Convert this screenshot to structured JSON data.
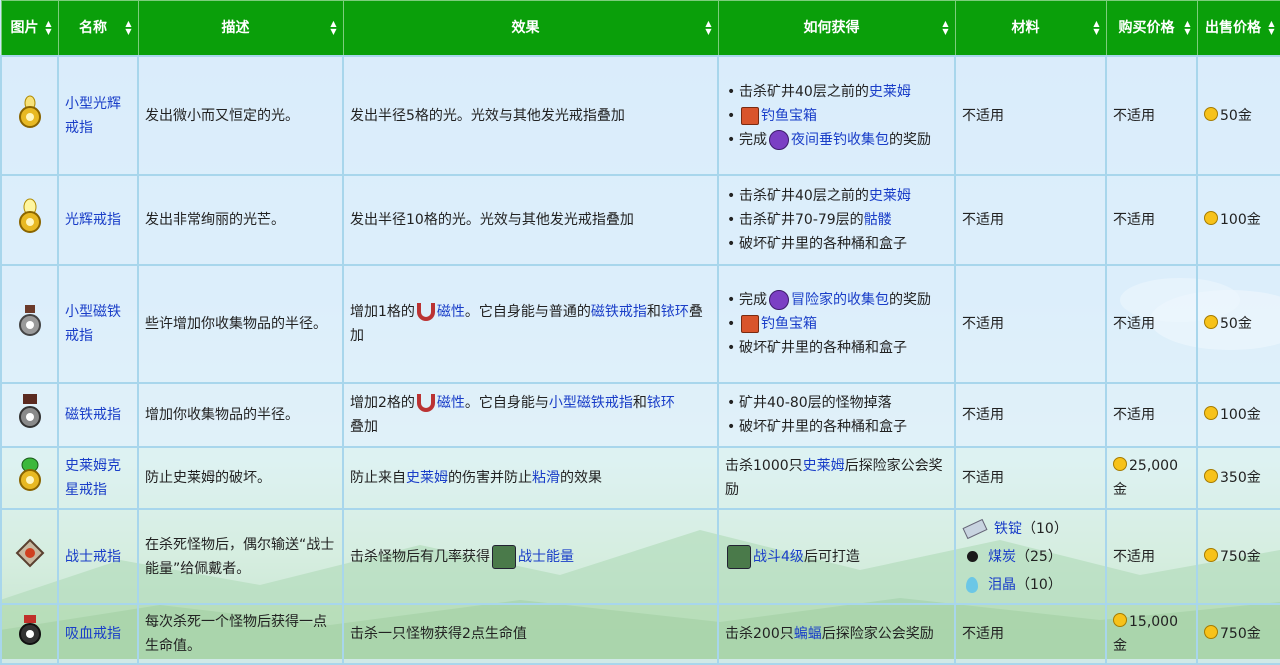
{
  "headers": [
    "图片",
    "名称",
    "描述",
    "效果",
    "如何获得",
    "材料",
    "购买价格",
    "出售价格"
  ],
  "rows": [
    {
      "name": "小型光辉戒指",
      "desc": "发出微小而又恒定的光。",
      "effect": "发出半径5格的光。光效与其他发光戒指叠加",
      "obtain": [
        {
          "pre": "击杀矿井40层之前的",
          "link": "史莱姆",
          "post": ""
        },
        {
          "pre": "",
          "link": "钓鱼宝箱",
          "post": ""
        },
        {
          "pre": "完成",
          "link": "夜间垂钓收集包",
          "post": "的奖励"
        }
      ],
      "material": "不适用",
      "buy": "不适用",
      "sell": "50金"
    },
    {
      "name": "光辉戒指",
      "desc": "发出非常绚丽的光芒。",
      "effect": "发出半径10格的光。光效与其他发光戒指叠加",
      "obtain": [
        {
          "pre": "击杀矿井40层之前的",
          "link": "史莱姆",
          "post": ""
        },
        {
          "pre": "击杀矿井70-79层的",
          "link": "骷髅",
          "post": ""
        },
        {
          "pre": "破坏矿井里的各种桶和盒子",
          "link": "",
          "post": ""
        }
      ],
      "material": "不适用",
      "buy": "不适用",
      "sell": "100金"
    },
    {
      "name": "小型磁铁戒指",
      "desc": "些许增加你收集物品的半径。",
      "effect_pre": "增加1格的",
      "effect_link": "磁性",
      "effect_mid": "。它自身能与普通的",
      "effect_link2": "磁铁戒指",
      "effect_and": "和",
      "effect_link3": "铱环",
      "effect_post": "叠加",
      "obtain": [
        {
          "pre": "完成",
          "link": "冒险家的收集包",
          "post": "的奖励"
        },
        {
          "pre": "",
          "link": "钓鱼宝箱",
          "post": ""
        },
        {
          "pre": "破坏矿井里的各种桶和盒子",
          "link": "",
          "post": ""
        }
      ],
      "material": "不适用",
      "buy": "不适用",
      "sell": "50金"
    },
    {
      "name": "磁铁戒指",
      "desc": "增加你收集物品的半径。",
      "effect_pre": "增加2格的",
      "effect_link": "磁性",
      "effect_mid": "。它自身能与",
      "effect_link2": "小型磁铁戒指",
      "effect_and": "和",
      "effect_link3": "铱环",
      "effect_post": "叠加",
      "obtain": [
        {
          "pre": "矿井40-80层的怪物掉落",
          "link": "",
          "post": ""
        },
        {
          "pre": "破坏矿井里的各种桶和盒子",
          "link": "",
          "post": ""
        }
      ],
      "material": "不适用",
      "buy": "不适用",
      "sell": "100金"
    },
    {
      "name": "史莱姆克星戒指",
      "desc": "防止史莱姆的破坏。",
      "effect_pre": "防止来自",
      "effect_link": "史莱姆",
      "effect_mid": "的伤害并防止",
      "effect_link2": "粘滑",
      "effect_post": "的效果",
      "obtain_pre": "击杀1000只",
      "obtain_link": "史莱姆",
      "obtain_post": "后探险家公会奖励",
      "material": "不适用",
      "buy": "25,000金",
      "sell": "350金"
    },
    {
      "name": "战士戒指",
      "desc": "在杀死怪物后，偶尔输送“战士能量”给佩戴者。",
      "effect_pre": "击杀怪物后有几率获得",
      "effect_link": "战士能量",
      "obtain_link": "战斗4级",
      "obtain_post": "后可打造",
      "materials": [
        {
          "name": "铁锭",
          "qty": "（10）"
        },
        {
          "name": "煤炭",
          "qty": "（25）"
        },
        {
          "name": "泪晶",
          "qty": "（10）"
        }
      ],
      "buy": "不适用",
      "sell": "750金"
    },
    {
      "name": "吸血戒指",
      "desc": "每次杀死一个怪物后获得一点生命值。",
      "effect": "击杀一只怪物获得2点生命值",
      "obtain_pre": "击杀200只",
      "obtain_link": "蝙蝠",
      "obtain_post": "后探险家公会奖励",
      "material": "不适用",
      "buy": "15,000金",
      "sell": "750金"
    }
  ],
  "colors": {
    "header": "#0a9f0a",
    "link": "#1a3ec8",
    "border": "#a8d6ec"
  }
}
